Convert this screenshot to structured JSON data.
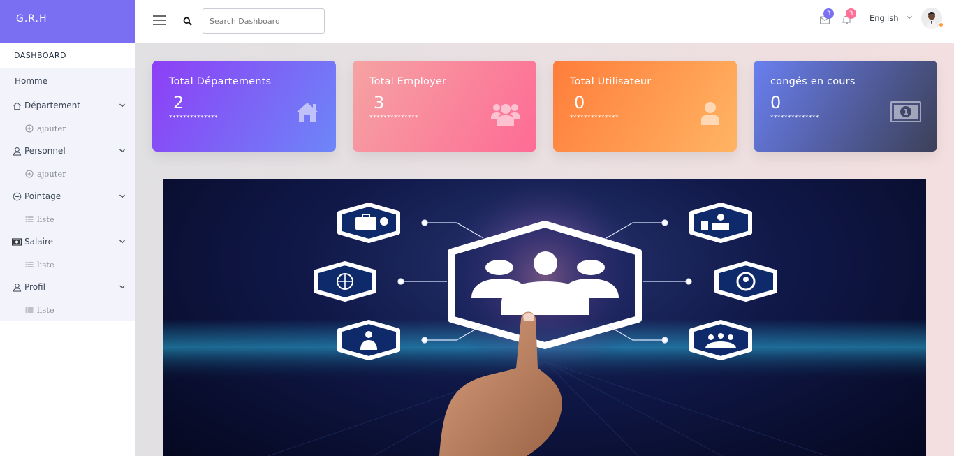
{
  "brand": "G.R.H",
  "sidebar": {
    "heading": "DASHBOARD",
    "home": "Homme",
    "sections": [
      {
        "label": "Département",
        "icon": "home-icon",
        "sub": [
          {
            "label": "ajouter",
            "icon": "plus-circle-icon"
          }
        ]
      },
      {
        "label": "Personnel",
        "icon": "user-icon",
        "sub": [
          {
            "label": "ajouter",
            "icon": "plus-circle-icon"
          }
        ]
      },
      {
        "label": "Pointage",
        "icon": "plus-circle-icon",
        "sub": [
          {
            "label": "liste",
            "icon": "list-icon"
          }
        ]
      },
      {
        "label": "Salaire",
        "icon": "money-icon",
        "sub": [
          {
            "label": "liste",
            "icon": "list-icon"
          }
        ]
      },
      {
        "label": "Profil",
        "icon": "user-icon",
        "sub": [
          {
            "label": "liste",
            "icon": "list-icon"
          }
        ]
      }
    ]
  },
  "topbar": {
    "search_placeholder": "Search Dashboard",
    "messages_count": "3",
    "notifications_count": "3",
    "language": "English"
  },
  "cards": [
    {
      "title": "Total Départements",
      "value": "2",
      "stars": "**************",
      "icon": "home-icon"
    },
    {
      "title": "Total Employer",
      "value": "3",
      "stars": "**************",
      "icon": "users-icon"
    },
    {
      "title": "Total Utilisateur",
      "value": "0",
      "stars": "**************",
      "icon": "user-icon"
    },
    {
      "title": "congés en cours",
      "value": "0",
      "stars": "**************",
      "icon": "money-bill-icon"
    }
  ],
  "colors": {
    "brand_bg": "#7a6ff2",
    "badge_messages": "#7a6ff2",
    "badge_notifications": "#fe7096"
  }
}
